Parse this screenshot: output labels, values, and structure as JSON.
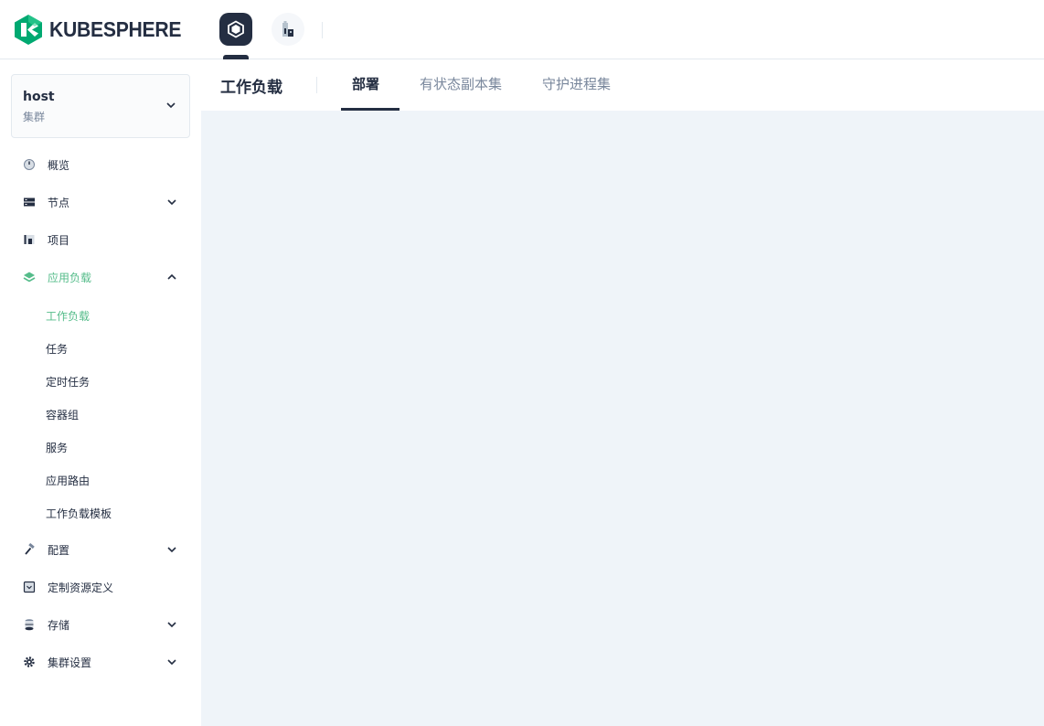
{
  "brand": {
    "logo_text": "KUBESPHERE",
    "accent_color": "#00a971",
    "dark_color": "#242e42"
  },
  "topnav": {
    "items": [
      {
        "icon": "cluster-cube-icon",
        "active": true
      },
      {
        "icon": "building-workspace-icon",
        "active": false
      }
    ]
  },
  "cluster": {
    "name": "host",
    "type": "集群"
  },
  "sidebar": {
    "items": [
      {
        "label": "概览",
        "icon": "gauge-icon",
        "expandable": false
      },
      {
        "label": "节点",
        "icon": "server-icon",
        "expandable": true
      },
      {
        "label": "项目",
        "icon": "project-icon",
        "expandable": false
      },
      {
        "label": "应用负载",
        "icon": "layers-icon",
        "expandable": true,
        "open": true
      },
      {
        "label": "配置",
        "icon": "hammer-icon",
        "expandable": true
      },
      {
        "label": "定制资源定义",
        "icon": "crd-icon",
        "expandable": false
      },
      {
        "label": "存储",
        "icon": "database-icon",
        "expandable": true
      },
      {
        "label": "集群设置",
        "icon": "gear-icon",
        "expandable": true
      }
    ],
    "subitems": [
      {
        "label": "工作负载",
        "active": true
      },
      {
        "label": "任务"
      },
      {
        "label": "定时任务"
      },
      {
        "label": "容器组"
      },
      {
        "label": "服务"
      },
      {
        "label": "应用路由"
      },
      {
        "label": "工作负载模板"
      }
    ]
  },
  "page": {
    "title": "工作负载",
    "tabs": [
      {
        "label": "部署",
        "active": true
      },
      {
        "label": "有状态副本集"
      },
      {
        "label": "守护进程集"
      }
    ]
  }
}
